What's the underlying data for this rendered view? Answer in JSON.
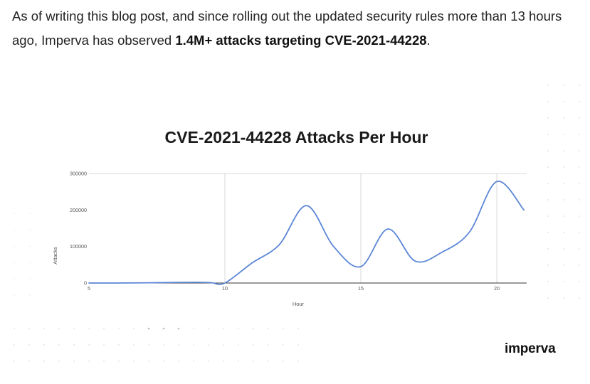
{
  "article": {
    "sentence_start": "As of writing this blog post, and since rolling out the updated security rules more than 13 hours ago, Imperva has observed ",
    "highlight": "1.4M+ attacks targeting CVE-2021-44228",
    "sentence_end": "."
  },
  "brand": {
    "logo_text": "imperva"
  },
  "colors": {
    "line": "#5b86d6",
    "grid": "#d9d9d9",
    "axis_text": "#555555"
  },
  "chart_data": {
    "type": "line",
    "title": "CVE-2021-44228 Attacks Per Hour",
    "xlabel": "Hour",
    "ylabel": "Attacks",
    "xlim": [
      5,
      21.1
    ],
    "ylim": [
      0,
      300000
    ],
    "x_ticks": [
      5,
      10,
      15,
      20
    ],
    "y_ticks": [
      0,
      100000,
      200000,
      300000
    ],
    "grid": "vertical lines at x ticks, top border",
    "legend": "none",
    "series": [
      {
        "x": [
          5,
          6,
          7,
          8,
          9,
          9.5,
          10,
          11,
          12,
          13,
          14,
          15,
          16,
          17,
          18,
          19,
          20,
          21
        ],
        "values": [
          0,
          0,
          500,
          1500,
          2000,
          1000,
          0,
          55000,
          105000,
          212000,
          100000,
          45000,
          148000,
          60000,
          85000,
          140000,
          278000,
          200000
        ]
      }
    ]
  }
}
